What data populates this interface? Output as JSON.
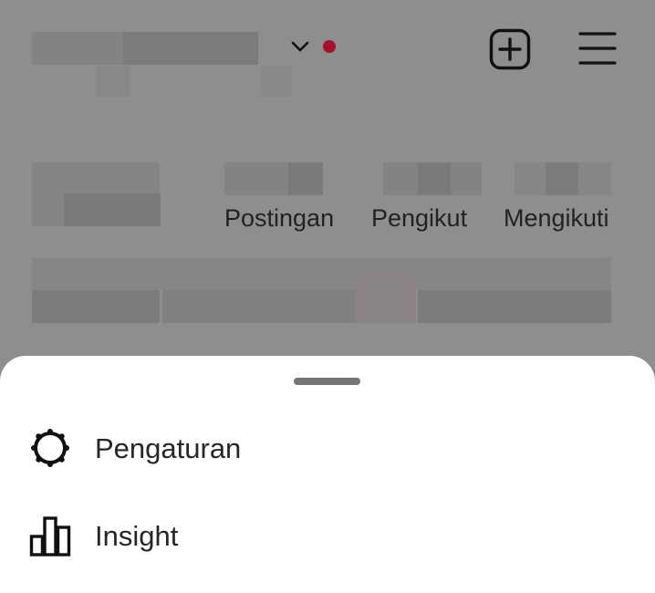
{
  "header": {
    "username_masked": "",
    "dropdown_icon": "chevron-down-icon",
    "notification_color": "#a5102c",
    "add_icon": "plus-square-icon",
    "menu_icon": "hamburger-menu-icon"
  },
  "profile": {
    "stats": [
      {
        "label": "Postingan"
      },
      {
        "label": "Pengikut"
      },
      {
        "label": "Mengikuti"
      }
    ]
  },
  "sheet": {
    "items": [
      {
        "label": "Pengaturan",
        "icon": "gear-icon"
      },
      {
        "label": "Insight",
        "icon": "bar-chart-icon"
      }
    ]
  }
}
